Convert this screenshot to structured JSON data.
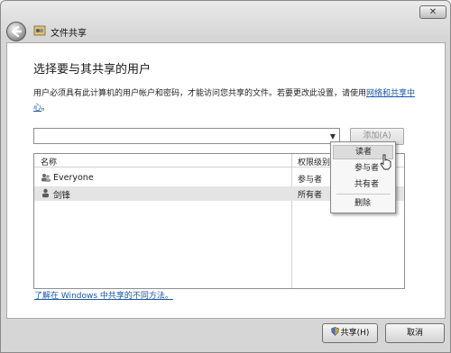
{
  "window": {
    "title": "文件共享",
    "close_label": "✕"
  },
  "main": {
    "heading": "选择要与其共享的用户",
    "description_prefix": "用户必须具有此计算机的用户帐户和密码，才能访问您共享的文件。若要更改此设置，请使用",
    "description_link": "网络和共享中心",
    "description_suffix": "。"
  },
  "picker": {
    "value": "",
    "add_button": "添加(A)"
  },
  "table": {
    "headers": {
      "name": "名称",
      "permission": "权限级别"
    },
    "rows": [
      {
        "name": "Everyone",
        "permission": "参与者"
      },
      {
        "name": "剑锋",
        "permission": "所有者"
      }
    ]
  },
  "permission_menu": {
    "items": [
      {
        "label": "读者",
        "hovered": true
      },
      {
        "label": "参与者"
      },
      {
        "label": "共有者"
      },
      {
        "label": "删除"
      }
    ]
  },
  "help_link": "了解在 Windows 中共享的不同方法。",
  "buttons": {
    "share": "共享(H)",
    "cancel": "取消"
  },
  "icons": {
    "back": "back-arrow-icon",
    "title": "shared-folder-icon",
    "user_group": "users-icon",
    "user": "user-icon",
    "shield": "uac-shield-icon"
  },
  "colors": {
    "link": "#1a56a8",
    "selected_row": "#e4e4e4"
  }
}
